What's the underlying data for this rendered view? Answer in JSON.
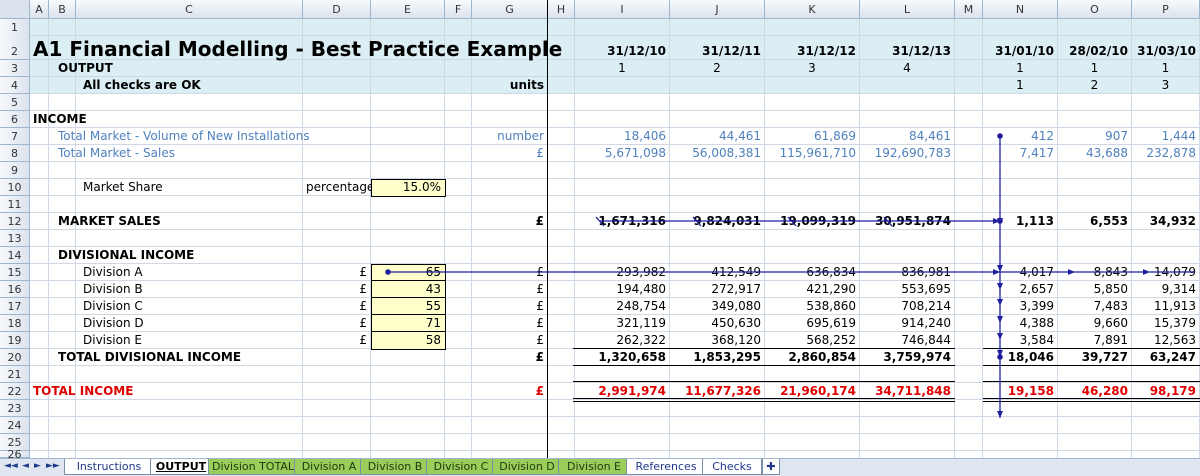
{
  "columns": [
    "A",
    "B",
    "C",
    "D",
    "E",
    "F",
    "G",
    "H",
    "I",
    "J",
    "K",
    "L",
    "M",
    "N",
    "O",
    "P"
  ],
  "rows": [
    "1",
    "2",
    "3",
    "4",
    "5",
    "6",
    "7",
    "8",
    "9",
    "10",
    "11",
    "12",
    "13",
    "14",
    "15",
    "16",
    "17",
    "18",
    "19",
    "20",
    "21",
    "22",
    "23",
    "24",
    "25",
    "26"
  ],
  "header": {
    "title": "A1 Financial Modelling - Best Practice Example",
    "output_label": "OUTPUT",
    "checks_text": "All checks are OK",
    "units_label": "units",
    "annual_dates": [
      "31/12/10",
      "31/12/11",
      "31/12/12",
      "31/12/13"
    ],
    "annual_index": [
      "1",
      "2",
      "3",
      "4"
    ],
    "monthly_dates": [
      "31/01/10",
      "28/02/10",
      "31/03/10"
    ],
    "monthly_index_a": [
      "1",
      "1",
      "1"
    ],
    "monthly_index_b": [
      "1",
      "2",
      "3"
    ]
  },
  "income": {
    "heading": "INCOME",
    "volume_label": "Total Market - Volume of New Installations",
    "volume_unit": "number",
    "volume_annual": [
      "18,406",
      "44,461",
      "61,869",
      "84,461"
    ],
    "volume_monthly": [
      "412",
      "907",
      "1,444"
    ],
    "sales_label": "Total Market - Sales",
    "sales_unit": "£",
    "sales_annual": [
      "5,671,098",
      "56,008,381",
      "115,961,710",
      "192,690,783"
    ],
    "sales_monthly": [
      "7,417",
      "43,688",
      "232,878"
    ],
    "share_label": "Market Share",
    "share_unit": "percentage",
    "share_value": "15.0%"
  },
  "market_sales": {
    "label": "MARKET SALES",
    "unit": "£",
    "annual": [
      "1,671,316",
      "9,824,031",
      "19,099,319",
      "30,951,874"
    ],
    "monthly": [
      "1,113",
      "6,553",
      "34,932"
    ]
  },
  "divisional": {
    "heading": "DIVISIONAL INCOME",
    "divisions": [
      {
        "name": "Division A",
        "unit": "£",
        "input": "65",
        "unit2": "£",
        "annual": [
          "293,982",
          "412,549",
          "636,834",
          "836,981"
        ],
        "monthly": [
          "4,017",
          "8,843",
          "14,079"
        ]
      },
      {
        "name": "Division B",
        "unit": "£",
        "input": "43",
        "unit2": "£",
        "annual": [
          "194,480",
          "272,917",
          "421,290",
          "553,695"
        ],
        "monthly": [
          "2,657",
          "5,850",
          "9,314"
        ]
      },
      {
        "name": "Division C",
        "unit": "£",
        "input": "55",
        "unit2": "£",
        "annual": [
          "248,754",
          "349,080",
          "538,860",
          "708,214"
        ],
        "monthly": [
          "3,399",
          "7,483",
          "11,913"
        ]
      },
      {
        "name": "Division D",
        "unit": "£",
        "input": "71",
        "unit2": "£",
        "annual": [
          "321,119",
          "450,630",
          "695,619",
          "914,240"
        ],
        "monthly": [
          "4,388",
          "9,660",
          "15,379"
        ]
      },
      {
        "name": "Division E",
        "unit": "£",
        "input": "58",
        "unit2": "£",
        "annual": [
          "262,322",
          "368,120",
          "568,252",
          "746,844"
        ],
        "monthly": [
          "3,584",
          "7,891",
          "12,563"
        ]
      }
    ],
    "total_label": "TOTAL DIVISIONAL INCOME",
    "total_unit": "£",
    "total_annual": [
      "1,320,658",
      "1,853,295",
      "2,860,854",
      "3,759,974"
    ],
    "total_monthly": [
      "18,046",
      "39,727",
      "63,247"
    ]
  },
  "total_income": {
    "label": "TOTAL INCOME",
    "unit": "£",
    "annual": [
      "2,991,974",
      "11,677,326",
      "21,960,174",
      "34,711,848"
    ],
    "monthly": [
      "19,158",
      "46,280",
      "98,179"
    ]
  },
  "tabs": [
    {
      "label": "Instructions",
      "style": "plain"
    },
    {
      "label": "OUTPUT",
      "style": "active"
    },
    {
      "label": "Division TOTAL",
      "style": "green"
    },
    {
      "label": "Division A",
      "style": "green"
    },
    {
      "label": "Division B",
      "style": "green"
    },
    {
      "label": "Division C",
      "style": "green"
    },
    {
      "label": "Division D",
      "style": "green"
    },
    {
      "label": "Division E",
      "style": "green"
    },
    {
      "label": "References",
      "style": "plain"
    },
    {
      "label": "Checks",
      "style": "plain"
    }
  ],
  "colors": {
    "blue": "#4f81bd",
    "red": "#e00000",
    "input_fill": "#ffffcc",
    "header_band": "#dbeef3",
    "arrow": "#1f1fa0"
  }
}
